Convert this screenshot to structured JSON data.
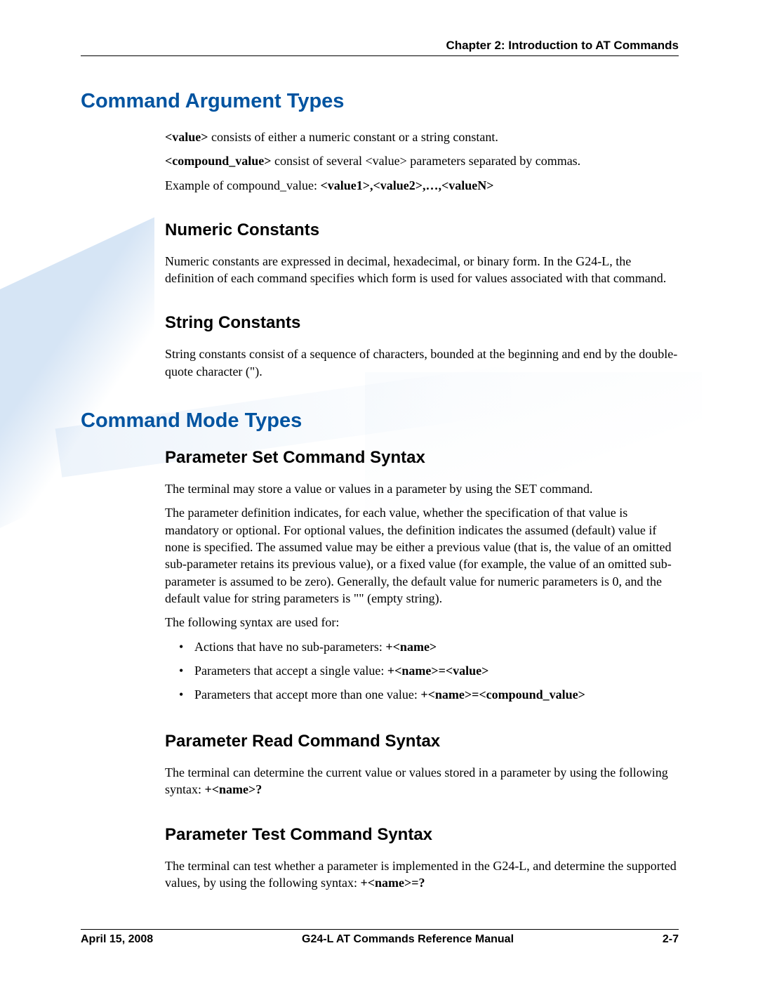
{
  "header": {
    "chapter": "Chapter 2:  Introduction to AT Commands"
  },
  "sections": {
    "cmdArgTypes": {
      "title": "Command Argument Types",
      "p1a": "<value>",
      "p1b": " consists of either a numeric constant or a string constant.",
      "p2a": "<compound_value>",
      "p2b": " consist of several <value> parameters separated by commas.",
      "p3a": "Example of compound_value: ",
      "p3b": "<value1>,<value2>,…,<valueN>"
    },
    "numConst": {
      "title": "Numeric Constants",
      "p1": "Numeric constants are expressed in decimal, hexadecimal, or binary form. In the G24-L, the definition of each command specifies which form is used for values associated with that command."
    },
    "strConst": {
      "title": "String Constants",
      "p1": "String constants consist of a sequence of characters, bounded at the beginning and end by the double-quote character (\")."
    },
    "cmdModeTypes": {
      "title": "Command Mode Types"
    },
    "paramSet": {
      "title": "Parameter Set Command Syntax",
      "p1": "The terminal may store a value or values in a parameter by using the SET command.",
      "p2": "The parameter definition indicates, for each value, whether the specification of that value is mandatory or optional. For optional values, the definition indicates the assumed (default) value if none is specified. The assumed value may be either a previous value (that is, the value of an omitted sub-parameter retains its previous value), or a fixed value (for example, the value of an omitted sub-parameter is assumed to be zero). Generally, the default value for numeric parameters is 0, and the default value for string parameters is \"\" (empty string).",
      "p3": "The following syntax are used for:",
      "bullets": {
        "b1a": "Actions that have no sub-parameters: ",
        "b1b": "+<name>",
        "b2a": "Parameters that accept a single value: ",
        "b2b": "+<name>=<value>",
        "b3a": "Parameters that accept more than one value: ",
        "b3b": "+<name>=<compound_value>"
      }
    },
    "paramRead": {
      "title": "Parameter Read Command Syntax",
      "p1a": "The terminal can determine the current value or values stored in a parameter by using the following syntax: ",
      "p1b": "+<name>?"
    },
    "paramTest": {
      "title": "Parameter Test Command Syntax",
      "p1a": "The terminal can test whether a parameter is implemented in the G24-L, and determine the supported values, by using the following syntax: ",
      "p1b": "+<name>=?"
    }
  },
  "footer": {
    "date": "April 15, 2008",
    "title": "G24-L AT Commands Reference Manual",
    "page": "2-7"
  }
}
